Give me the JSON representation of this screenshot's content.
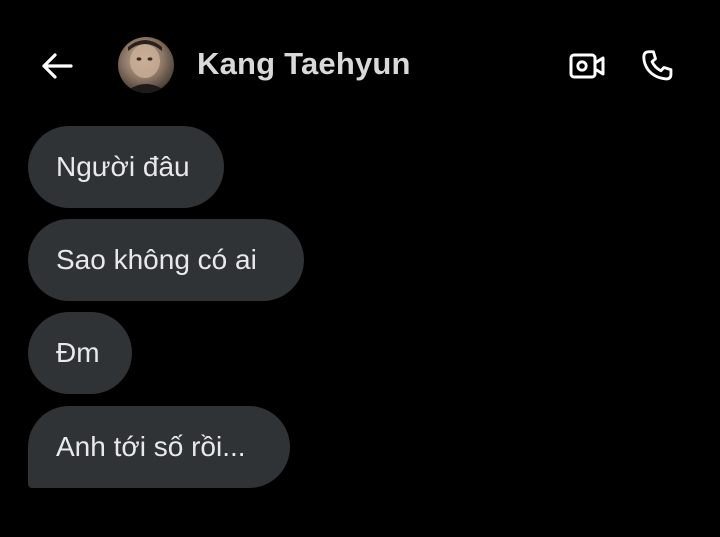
{
  "header": {
    "contact_name": "Kang Taehyun",
    "icons": {
      "back": "arrow-left-icon",
      "video": "video-camera-icon",
      "call": "phone-icon"
    }
  },
  "messages": [
    {
      "text": "Người đâu"
    },
    {
      "text": "Sao không có ai"
    },
    {
      "text": "Đm"
    },
    {
      "text": "Anh tới số rồi..."
    }
  ],
  "colors": {
    "background": "#000000",
    "bubble": "#2f3336",
    "text": "#e7e9ea"
  }
}
